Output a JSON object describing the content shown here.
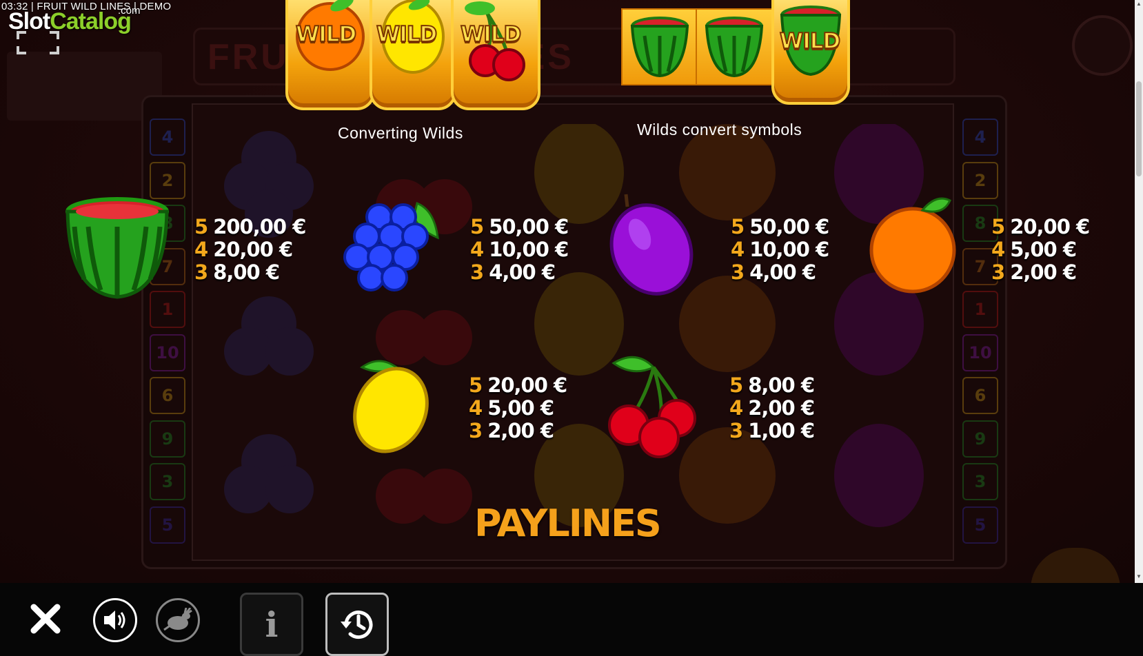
{
  "status_bar": {
    "text": "03:32 | FRUIT WILD LINES | DEMO"
  },
  "logo": {
    "part1": "Slot",
    "part2": "Catalog",
    "suffix": ".com"
  },
  "wilds_section": {
    "converting_caption": "Converting Wilds",
    "convert_caption": "Wilds convert symbols",
    "wild_label": "WILD"
  },
  "paytable": {
    "watermelon": {
      "rows": [
        {
          "count": "5",
          "amount": "200,00 €"
        },
        {
          "count": "4",
          "amount": "20,00 €"
        },
        {
          "count": "3",
          "amount": "8,00 €"
        }
      ]
    },
    "grapes": {
      "rows": [
        {
          "count": "5",
          "amount": "50,00 €"
        },
        {
          "count": "4",
          "amount": "10,00 €"
        },
        {
          "count": "3",
          "amount": "4,00 €"
        }
      ]
    },
    "plum": {
      "rows": [
        {
          "count": "5",
          "amount": "50,00 €"
        },
        {
          "count": "4",
          "amount": "10,00 €"
        },
        {
          "count": "3",
          "amount": "4,00 €"
        }
      ]
    },
    "orange": {
      "rows": [
        {
          "count": "5",
          "amount": "20,00 €"
        },
        {
          "count": "4",
          "amount": "5,00 €"
        },
        {
          "count": "3",
          "amount": "2,00 €"
        }
      ]
    },
    "lemon": {
      "rows": [
        {
          "count": "5",
          "amount": "20,00 €"
        },
        {
          "count": "4",
          "amount": "5,00 €"
        },
        {
          "count": "3",
          "amount": "2,00 €"
        }
      ]
    },
    "cherry": {
      "rows": [
        {
          "count": "5",
          "amount": "8,00 €"
        },
        {
          "count": "4",
          "amount": "2,00 €"
        },
        {
          "count": "3",
          "amount": "1,00 €"
        }
      ]
    }
  },
  "paylines_title": "PAYLINES",
  "background_line_numbers": [
    "4",
    "2",
    "8",
    "7",
    "1",
    "10",
    "6",
    "9",
    "3",
    "5"
  ],
  "line_number_colors": [
    "#2d4fd6",
    "#d6a21a",
    "#1f9a2a",
    "#c4741a",
    "#c21c1c",
    "#8a1fb0",
    "#d6a21a",
    "#1f9a2a",
    "#1f9a2a",
    "#3a2cb0"
  ],
  "toolbar": {
    "close_icon": "close-icon",
    "sound_icon": "speaker-icon",
    "turbo_icon": "rabbit-icon",
    "info_label": "i",
    "history_icon": "history-clock-icon"
  },
  "colors": {
    "accent": "#f5a11b",
    "toolbar_bg": "#060606"
  }
}
